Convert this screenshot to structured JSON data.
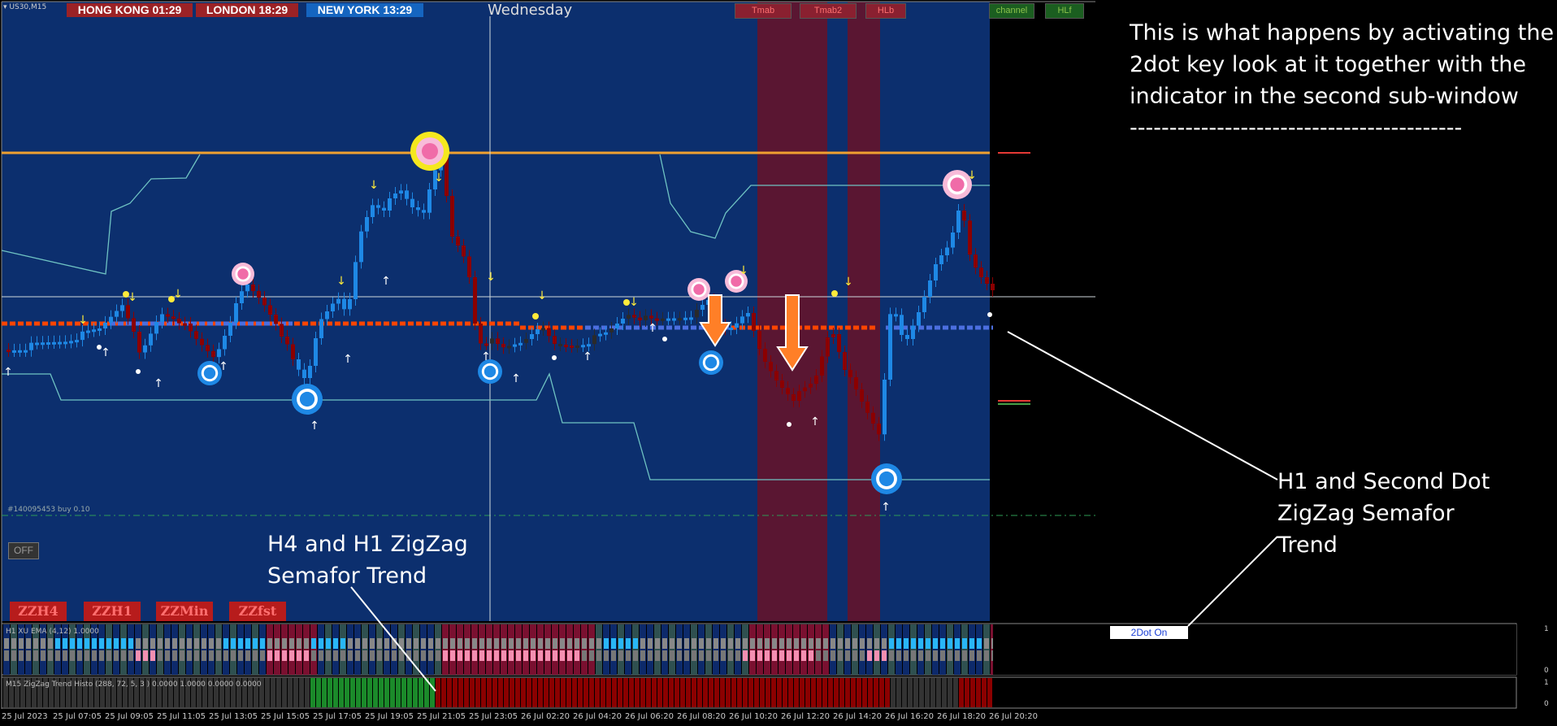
{
  "symbol_label": "US30,M15",
  "sessions": [
    {
      "label": "HONG KONG",
      "time": "01:29",
      "color": "#9b2226"
    },
    {
      "label": "LONDON",
      "time": "18:29",
      "color": "#9b2226"
    },
    {
      "label": "NEW YORK",
      "time": "13:29",
      "color": "#1565c0"
    }
  ],
  "day_label": "Wednesday",
  "top_buttons": [
    "Tmab",
    "Tmab2",
    "HLb",
    "channel",
    "HLf"
  ],
  "order_label": "#140095453 buy 0.10",
  "off_button": "OFF",
  "zz_buttons": [
    "ZZH4",
    "ZZH1",
    "ZZMin",
    "ZZfst"
  ],
  "subwindow1": {
    "label": "H1 XU EMA (4,12) 1.0000",
    "scale_top": "1",
    "scale_bottom": "0"
  },
  "subwindow2": {
    "label": "M15 ZigZag Trend Histo (288, 72, 5, 3 ) 0.0000 1.0000 0.0000 0.0000",
    "scale_top": "1",
    "scale_bottom": "0"
  },
  "two_dot_button": "2Dot On",
  "annotations": {
    "main_note": [
      "This is what happens by activating the",
      "2dot key look at it together with the",
      "indicator in the second sub-window",
      "------------------------------------------"
    ],
    "h1_note": [
      "H1 and Second Dot",
      "ZigZag Semafor",
      "Trend"
    ],
    "h4_note": [
      "H4 and H1 ZigZag",
      "Semafor Trend"
    ]
  },
  "time_axis": [
    "25 Jul 2023",
    "25 Jul 07:05",
    "25 Jul 09:05",
    "25 Jul 11:05",
    "25 Jul 13:05",
    "25 Jul 15:05",
    "25 Jul 17:05",
    "25 Jul 19:05",
    "25 Jul 21:05",
    "25 Jul 23:05",
    "26 Jul 02:20",
    "26 Jul 04:20",
    "26 Jul 06:20",
    "26 Jul 08:20",
    "26 Jul 10:20",
    "26 Jul 12:20",
    "26 Jul 14:20",
    "26 Jul 16:20",
    "26 Jul 18:20",
    "26 Jul 20:20"
  ],
  "colors": {
    "chart_bg": "#0c2f6e",
    "bear_candle": "#8b0000",
    "bull_candle": "#1e88e5",
    "neutral_candle": "#2a2a2a",
    "resistance_line": "#f0a030",
    "channel_line": "#6fc3c3",
    "highlight_zone": "#5a1632"
  }
}
